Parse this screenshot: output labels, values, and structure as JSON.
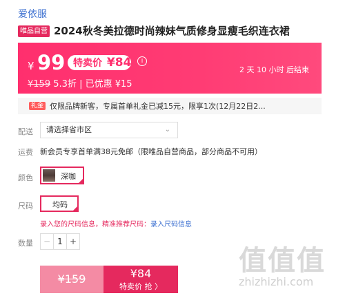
{
  "brand": "爱依服",
  "product": {
    "badge": "唯品自营",
    "title": "2024秋冬美拉德时尚辣妹气质修身显瘦毛织连衣裙"
  },
  "price": {
    "currency": "¥",
    "current": "99",
    "sale_label": "特卖价",
    "sale_amount": "¥84",
    "original": "¥159",
    "discount": "5.3折",
    "separator": "|",
    "saved": "已优惠 ¥15",
    "info_icon": "i",
    "countdown": "2 天 10 小时 后结束"
  },
  "coupon": {
    "tag": "礼金",
    "text": "仅限品牌新客，专属首单礼金已减15元，限享1次(12月22日2..."
  },
  "delivery": {
    "label": "配送",
    "placeholder": "请选择省市区",
    "chevron": "⌄"
  },
  "shipping": {
    "label": "运费",
    "text": "新会员专享首单满38元免邮（限唯品自营商品，部分商品不可用）"
  },
  "color": {
    "label": "颜色",
    "option": "深咖"
  },
  "size": {
    "label": "尺码",
    "option": "均码",
    "hint_link": "录入您的尺码信息，精准推荐尺码：",
    "hint_action": "录入尺码信息"
  },
  "quantity": {
    "label": "数量",
    "minus": "−",
    "value": "1",
    "plus": "+"
  },
  "buttons": {
    "original_price": "¥159",
    "sale_price": "¥84",
    "buy_label": "特卖价 抢 〉"
  },
  "watermark": {
    "logo": "值值值",
    "text": "zhizhizhi.com"
  },
  "colors": {
    "accent": "#e5295e",
    "banner": "#ff2f6e",
    "link": "#3b6fd0"
  }
}
